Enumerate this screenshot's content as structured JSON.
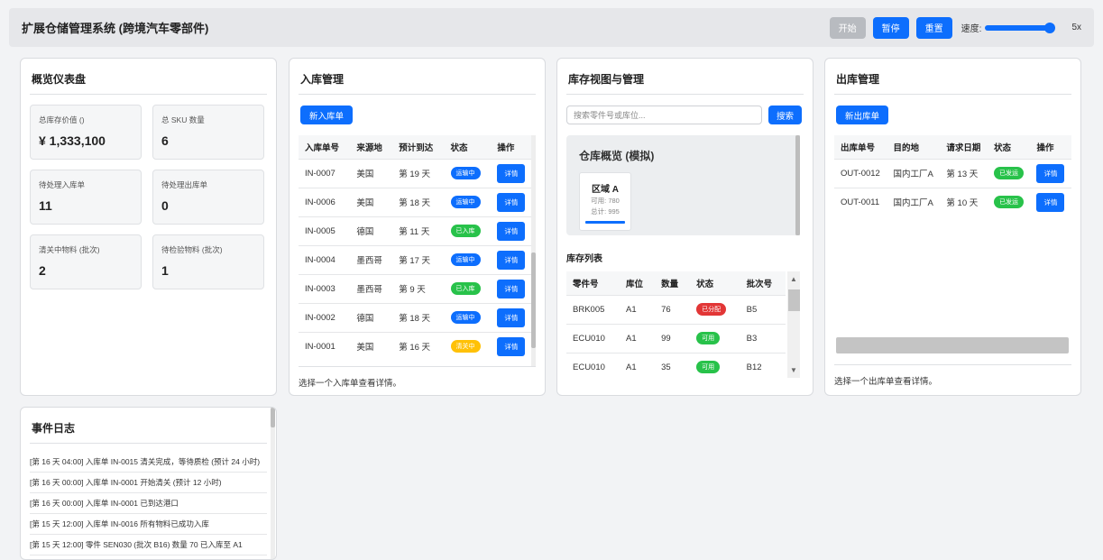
{
  "header": {
    "title": "扩展仓储管理系统 (跨境汽车零部件)",
    "start_label": "开始",
    "pause_label": "暂停",
    "reset_label": "重置",
    "speed_label": "速度:",
    "speed_value": "5x",
    "speed_fraction": 1.0
  },
  "dashboard": {
    "title": "概览仪表盘",
    "stats": [
      {
        "label": "总库存价值 ()",
        "value": "¥ 1,333,100"
      },
      {
        "label": "总 SKU 数量",
        "value": "6"
      },
      {
        "label": "待处理入库单",
        "value": "11"
      },
      {
        "label": "待处理出库单",
        "value": "0"
      },
      {
        "label": "清关中物料 (批次)",
        "value": "2"
      },
      {
        "label": "待检验物料 (批次)",
        "value": "1"
      }
    ]
  },
  "inbound": {
    "title": "入库管理",
    "new_label": "新入库单",
    "columns": [
      "入库单号",
      "来源地",
      "预计到达",
      "状态",
      "操作"
    ],
    "rows": [
      {
        "id": "IN-0007",
        "origin": "美国",
        "eta": "第 19 天",
        "status": "运输中",
        "status_color": "blue",
        "action": "详情"
      },
      {
        "id": "IN-0006",
        "origin": "美国",
        "eta": "第 18 天",
        "status": "运输中",
        "status_color": "blue",
        "action": "详情"
      },
      {
        "id": "IN-0005",
        "origin": "德国",
        "eta": "第 11 天",
        "status": "已入库",
        "status_color": "green",
        "action": "详情"
      },
      {
        "id": "IN-0004",
        "origin": "墨西哥",
        "eta": "第 17 天",
        "status": "运输中",
        "status_color": "blue",
        "action": "详情"
      },
      {
        "id": "IN-0003",
        "origin": "墨西哥",
        "eta": "第 9 天",
        "status": "已入库",
        "status_color": "green",
        "action": "详情"
      },
      {
        "id": "IN-0002",
        "origin": "德国",
        "eta": "第 18 天",
        "status": "运输中",
        "status_color": "blue",
        "action": "详情"
      },
      {
        "id": "IN-0001",
        "origin": "美国",
        "eta": "第 16 天",
        "status": "清关中",
        "status_color": "yellow",
        "action": "详情"
      }
    ],
    "footer": "选择一个入库单查看详情。"
  },
  "inventory": {
    "title": "库存视图与管理",
    "search_placeholder": "搜索零件号或库位...",
    "search_label": "搜索",
    "overview_title": "仓库概览 (模拟)",
    "zone": {
      "name": "区域 A",
      "available": "可用: 780",
      "total": "总计: 995"
    },
    "list_title": "库存列表",
    "columns": [
      "零件号",
      "库位",
      "数量",
      "状态",
      "批次号"
    ],
    "rows": [
      {
        "part": "BRK005",
        "loc": "A1",
        "qty": "76",
        "status": "已分配",
        "status_color": "red",
        "batch": "B5"
      },
      {
        "part": "ECU010",
        "loc": "A1",
        "qty": "99",
        "status": "可用",
        "status_color": "green",
        "batch": "B3"
      },
      {
        "part": "ECU010",
        "loc": "A1",
        "qty": "35",
        "status": "可用",
        "status_color": "green",
        "batch": "B12"
      }
    ]
  },
  "outbound": {
    "title": "出库管理",
    "new_label": "新出库单",
    "columns": [
      "出库单号",
      "目的地",
      "请求日期",
      "状态",
      "操作"
    ],
    "rows": [
      {
        "id": "OUT-0012",
        "dest": "国内工厂A",
        "date": "第 13 天",
        "status": "已发运",
        "status_color": "green",
        "action": "详情"
      },
      {
        "id": "OUT-0011",
        "dest": "国内工厂A",
        "date": "第 10 天",
        "status": "已发运",
        "status_color": "green",
        "action": "详情"
      }
    ],
    "footer": "选择一个出库单查看详情。"
  },
  "eventlog": {
    "title": "事件日志",
    "items": [
      "[第 16 天 04:00] 入库单 IN-0015 清关完成，等待质检 (预计 24 小时)",
      "[第 16 天 00:00] 入库单 IN-0001 开始清关 (预计 12 小时)",
      "[第 16 天 00:00] 入库单 IN-0001 已到达港口",
      "[第 15 天 12:00] 入库单 IN-0016 所有物料已成功入库",
      "[第 15 天 12:00] 零件 SEN030 (批次 B16) 数量 70 已入库至 A1"
    ]
  }
}
